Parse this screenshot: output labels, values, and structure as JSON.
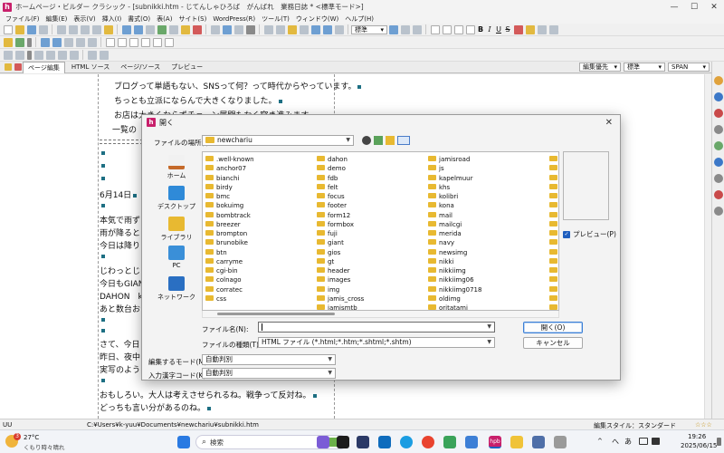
{
  "window": {
    "title": "ホームページ・ビルダー クラシック - [subnikki.htm - じてんしゃひろば　がんばれ　業務日誌 * <標準モード>]",
    "minimize": "—",
    "maximize": "☐",
    "close": "✕"
  },
  "menu": [
    "ファイル(F)",
    "編集(E)",
    "表示(V)",
    "挿入(I)",
    "書式(O)",
    "表(A)",
    "サイト(S)",
    "WordPress(R)",
    "ツール(T)",
    "ウィンドウ(W)",
    "ヘルプ(H)"
  ],
  "toolbar": {
    "style_select": "標準",
    "bold": "B",
    "italic": "I",
    "underline": "U",
    "strike": "S"
  },
  "modebar": {
    "tabs": [
      "ページ編集",
      "HTML ソース",
      "ページ/ソース",
      "プレビュー"
    ],
    "edit_priority": "編集優先",
    "style_value": "標準",
    "tag_value": "SPAN"
  },
  "editor": {
    "lines": [
      "ブログって単語もない、SNSって何？って時代からやっています。",
      "ちっとも立派にならんで大きくなりました。",
      "お店は大きくならずチェーン展開もなく突き進みます。",
      "一覧の",
      "6月14日",
      "本気で雨ず",
      "雨が降ると",
      "今日は降り",
      "じわっとじ",
      "今日もGIAN",
      "DAHON　k",
      "あと数台お",
      "さて、今日",
      "昨日、夜中",
      "実写のよう",
      "おもしろい。大人は考えさせられるね。戦争って反対ね。",
      "どっちも言い分があるのね。"
    ]
  },
  "dialog": {
    "title": "開く",
    "close": "✕",
    "location_label": "ファイルの場所(I):",
    "location_value": "newchariu",
    "places": [
      "ホーム",
      "デスクトップ",
      "ライブラリ",
      "PC",
      "ネットワーク"
    ],
    "files": [
      [
        ".well-known",
        "anchor07",
        "bianchi",
        "birdy",
        "bmc",
        "bokuimg",
        "bombtrack",
        "breezer",
        "brompton",
        "brunobike",
        "btn",
        "carryme",
        "cgi-bin",
        "colnago",
        "corratec",
        "css"
      ],
      [
        "dahon",
        "demo",
        "fdb",
        "felt",
        "focus",
        "footer",
        "form12",
        "formbox",
        "fuji",
        "giant",
        "gios",
        "gt",
        "header",
        "images",
        "img",
        "jamis_cross",
        "jamismtb"
      ],
      [
        "jamisroad",
        "js",
        "kapelmuur",
        "khs",
        "kolibri",
        "kona",
        "mail",
        "mailcgi",
        "merida",
        "navy",
        "newsimg",
        "nikki",
        "nikkiimg",
        "nikkiimg06",
        "nikkiimg0718",
        "oldimg",
        "oritatami"
      ],
      [
        "osi",
        "oxf",
        "pac",
        "pac",
        "pac",
        "ral",
        "rea",
        "rid",
        "roc",
        "sak",
        "scc",
        "she",
        "sp",
        "sto",
        "tar",
        "tat",
        "ter",
        "ter"
      ]
    ],
    "filename_label": "ファイル名(N):",
    "filename_value": "",
    "filetype_label": "ファイルの種類(T):",
    "filetype_value": "HTML ファイル (*.html;*.htm;*.shtml;*.shtm)",
    "open_button": "開く(O)",
    "cancel_button": "キャンセル",
    "preview_label": "プレビュー(P)",
    "edit_mode_label": "編集するモード(M):",
    "edit_mode_value": "自動判別",
    "input_code_label": "入力漢字コード(K):",
    "input_code_value": "自動判別"
  },
  "statusbar": {
    "left": "UU",
    "path": "C:¥Users¥k-yuu¥Documents¥newchariu¥subnikki.htm",
    "style": "編集スタイル：スタンダード"
  },
  "taskbar": {
    "weather_temp": "27°C",
    "weather_desc": "くもり時々晴れ",
    "weather_badge": "3",
    "search_placeholder": "検索",
    "ime_a": "へ",
    "ime_mode": "あ",
    "time": "19:26",
    "date": "2025/06/15"
  },
  "colors": {
    "app_accent": "#c8206b",
    "folder": "#e8b931",
    "primary_button_border": "#3b7fd6"
  }
}
